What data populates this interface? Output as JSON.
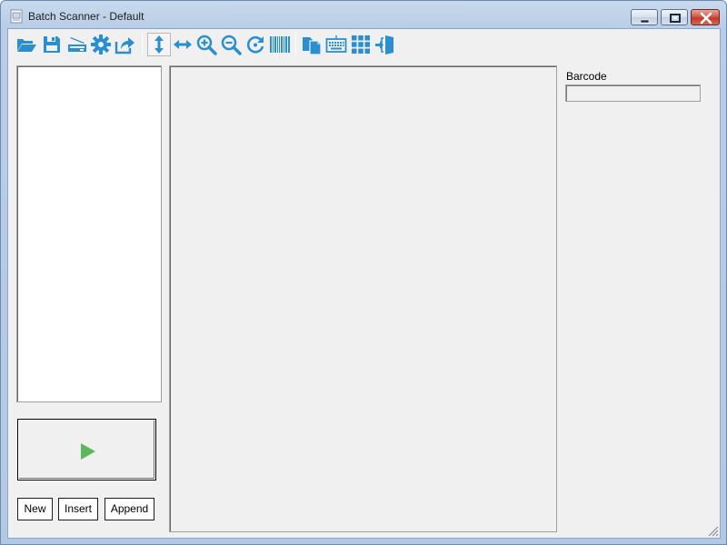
{
  "window": {
    "title": "Batch Scanner - Default",
    "controls": [
      "minimize",
      "maximize",
      "close"
    ]
  },
  "toolbar": {
    "accent_color": "#2a8fd0",
    "buttons": [
      {
        "icon": "folder-open-icon",
        "action": "open"
      },
      {
        "icon": "save-icon",
        "action": "save"
      },
      {
        "icon": "scanner-icon",
        "action": "scan"
      },
      {
        "icon": "gear-icon",
        "action": "settings"
      },
      {
        "icon": "share-icon",
        "action": "export"
      },
      {
        "icon": "fit-height-icon",
        "action": "fit-height",
        "pressed": true
      },
      {
        "icon": "fit-width-icon",
        "action": "fit-width"
      },
      {
        "icon": "zoom-in-icon",
        "action": "zoom-in"
      },
      {
        "icon": "zoom-out-icon",
        "action": "zoom-out"
      },
      {
        "icon": "rotate-icon",
        "action": "rotate"
      },
      {
        "icon": "barcode-icon",
        "action": "barcode"
      },
      {
        "icon": "copy-icon",
        "action": "copy"
      },
      {
        "icon": "keyboard-icon",
        "action": "keyboard"
      },
      {
        "icon": "grid-icon",
        "action": "grid"
      },
      {
        "icon": "exit-door-icon",
        "action": "exit"
      }
    ]
  },
  "barcode": {
    "label": "Barcode",
    "value": ""
  },
  "start_button": {
    "icon": "play-icon",
    "color": "#5cb85c"
  },
  "page_buttons": {
    "new": "New",
    "insert": "Insert",
    "append": "Append"
  }
}
